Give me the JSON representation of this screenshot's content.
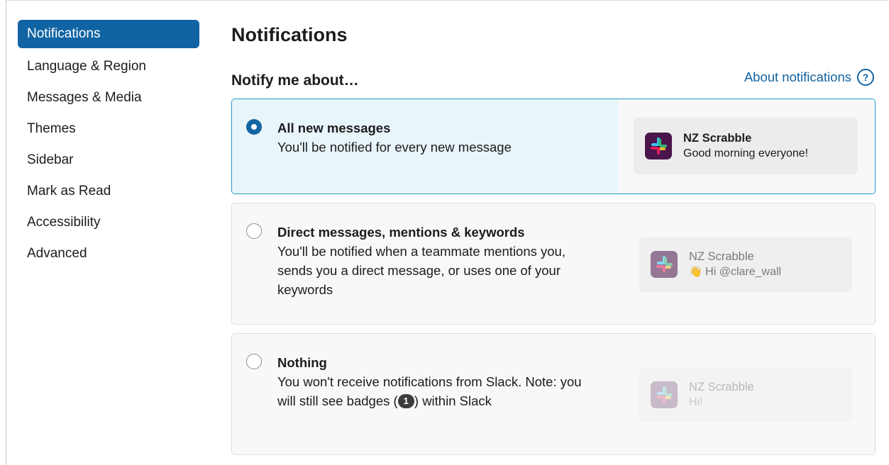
{
  "sidebar": {
    "items": [
      {
        "label": "Notifications",
        "active": true
      },
      {
        "label": "Language & Region"
      },
      {
        "label": "Messages & Media"
      },
      {
        "label": "Themes"
      },
      {
        "label": "Sidebar"
      },
      {
        "label": "Mark as Read"
      },
      {
        "label": "Accessibility"
      },
      {
        "label": "Advanced"
      }
    ]
  },
  "main": {
    "title": "Notifications",
    "section_title": "Notify me about…",
    "about_link": "About notifications",
    "help_icon": "?",
    "options": [
      {
        "title": "All new messages",
        "description": "You'll be notified for every new message",
        "selected": true,
        "preview": {
          "name": "NZ Scrabble",
          "message": "Good morning everyone!"
        }
      },
      {
        "title": "Direct messages, mentions & keywords",
        "description": "You'll be notified when a teammate mentions you, sends you a direct message, or uses one of your keywords",
        "selected": false,
        "preview": {
          "name": "NZ Scrabble",
          "emoji": "👋",
          "message": "Hi @clare_wall"
        }
      },
      {
        "title": "Nothing",
        "description_before": "You won't receive notifications from Slack. Note: you will still see badges (",
        "badge": "1",
        "description_after": ") within Slack",
        "selected": false,
        "preview": {
          "name": "NZ Scrabble",
          "message": "Hi!"
        }
      }
    ]
  },
  "colors": {
    "accent": "#1264a3",
    "active_nav": "#1164a3",
    "selected_border": "#1d9bd1",
    "selected_bg": "#e8f5fa",
    "slack_aubergine": "#4a154b"
  }
}
